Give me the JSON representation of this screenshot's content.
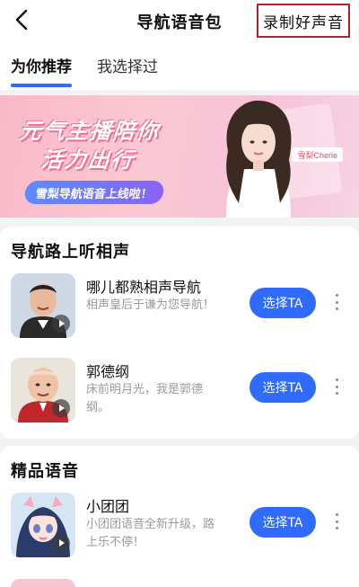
{
  "header": {
    "title": "导航语音包",
    "record_label": "录制好声音"
  },
  "tabs": [
    {
      "label": "为你推荐",
      "active": true
    },
    {
      "label": "我选择过",
      "active": false
    }
  ],
  "banner": {
    "line1": "元气主播陪你",
    "line2": "活力出行",
    "pill": "雪梨导航语音上线啦！",
    "tag": "雪梨Cherie"
  },
  "sections": [
    {
      "title": "导航路上听相声",
      "items": [
        {
          "name": "哪儿都熟相声导航",
          "desc": "相声皇后于谦为您导航！",
          "button": "选择TA"
        },
        {
          "name": "郭德纲",
          "desc": "床前明月光，我是郭德纲。",
          "button": "选择TA"
        }
      ]
    },
    {
      "title": "精品语音",
      "items": [
        {
          "name": "小团团",
          "desc": "小团团语音全新升级，路上乐不停！",
          "button": "选择TA"
        }
      ]
    }
  ],
  "colors": {
    "accent": "#2f6bff",
    "highlight_border": "#b0222a",
    "banner_pink": "#f9b8c7"
  }
}
